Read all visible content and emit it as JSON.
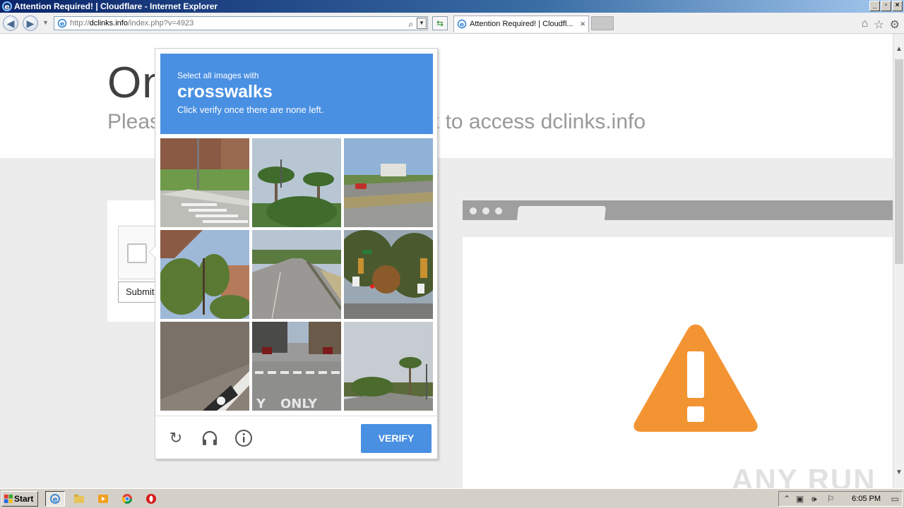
{
  "window": {
    "title": "Attention Required! | Cloudflare - Internet Explorer"
  },
  "address_bar": {
    "scheme": "http://",
    "domain": "dclinks.info",
    "path": "/index.php?v=4923"
  },
  "tab": {
    "label": "Attention Required! | Cloudfl..."
  },
  "page": {
    "heading": "On",
    "subheading": "Please complete the security check to access dclinks.info",
    "submit_label": "Submit"
  },
  "captcha": {
    "prompt_small": "Select all images with",
    "target": "crosswalks",
    "instruction": "Click verify once there are none left.",
    "verify_label": "VERIFY",
    "tiles": [
      "tile-1",
      "tile-2",
      "tile-3",
      "tile-4",
      "tile-5",
      "tile-6",
      "tile-7",
      "tile-8",
      "tile-9"
    ],
    "accent_color": "#4a90e2"
  },
  "watermark": "ANY RUN",
  "taskbar": {
    "start_label": "Start",
    "clock": "6:05 PM"
  },
  "colors": {
    "warning": "#f39433",
    "captcha_blue": "#4a90e2"
  }
}
